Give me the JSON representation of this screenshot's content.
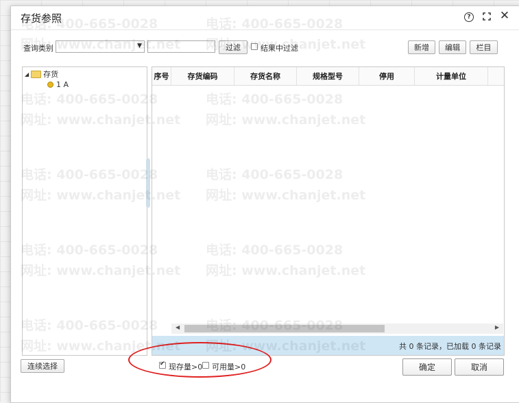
{
  "dialog": {
    "title": "存货参照",
    "help_glyph": "?",
    "close_glyph": "✕"
  },
  "filter": {
    "query_label": "查询类别",
    "filter_button": "过滤",
    "in_result_label": "结果中过滤"
  },
  "toolbar": {
    "new_label": "新增",
    "edit_label": "编辑",
    "columns_label": "栏目"
  },
  "tree": {
    "root_label": "存货",
    "child_label": "1 A"
  },
  "grid": {
    "columns": [
      "序号",
      "存货编码",
      "存货名称",
      "规格型号",
      "停用",
      "计量单位"
    ],
    "status_text": "共 0 条记录，已加载 0 条记录"
  },
  "footer": {
    "continuous_select_label": "连续选择",
    "in_stock_label": "现存量>0",
    "available_label": "可用量>0",
    "ok_label": "确定",
    "cancel_label": "取消"
  },
  "watermark": {
    "phone": "电话: 400-665-0028",
    "site": "网址: www.chanjet.net"
  }
}
